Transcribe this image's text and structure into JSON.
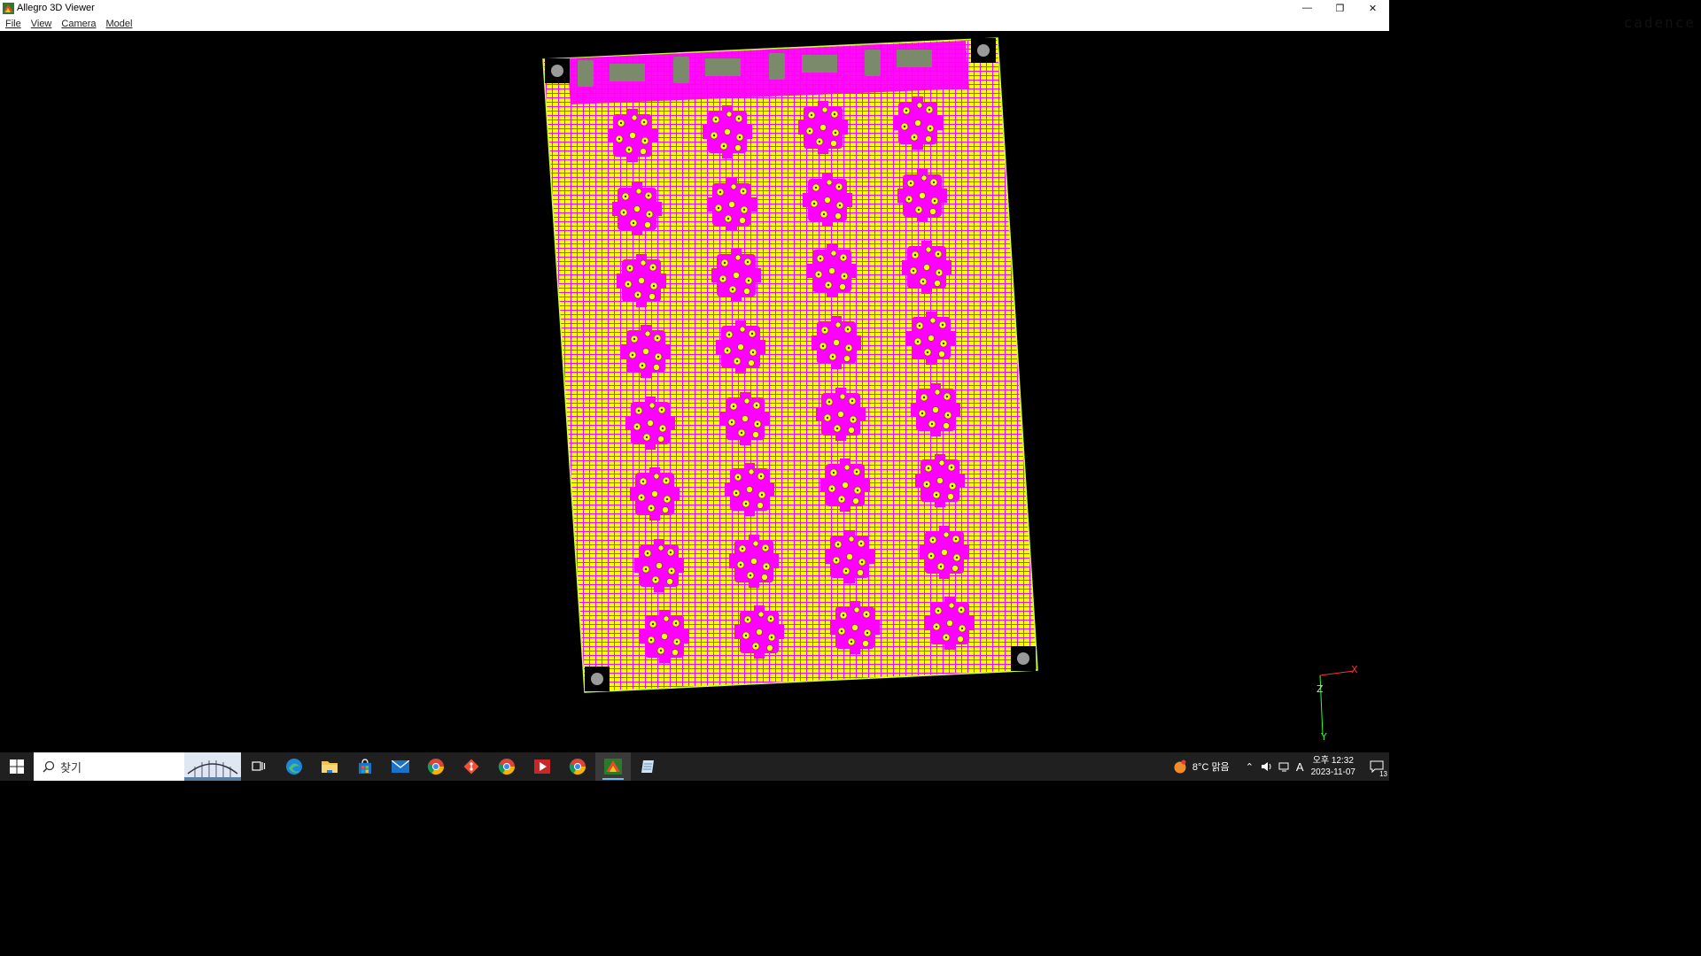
{
  "window": {
    "title": "Allegro 3D Viewer",
    "minimize_glyph": "—",
    "restore_glyph": "❐",
    "close_glyph": "✕"
  },
  "menu": {
    "items": [
      "File",
      "View",
      "Camera",
      "Model"
    ]
  },
  "brand": "cadence",
  "viewport": {
    "background": "#000000",
    "board_colors": {
      "substrate": "#ffff00",
      "copper": "#ff00ff",
      "outline": "#c8ff3c",
      "pads": "#7a8a6a",
      "mount_holes": "#9a9a9a"
    },
    "axes": {
      "x_label": "X",
      "y_label": "Y",
      "z_label": "Z"
    }
  },
  "taskbar": {
    "search_placeholder": "찾기",
    "icons": [
      "windows-start-icon",
      "task-view-icon",
      "edge-icon",
      "file-explorer-icon",
      "store-icon",
      "mail-icon",
      "chrome-icon",
      "git-icon",
      "chrome-alt-icon",
      "media-icon",
      "chrome-profile-icon",
      "allegro-icon",
      "notepad-icon"
    ],
    "weather": "8°C 맑음",
    "ime": "A",
    "time": "오후 12:32",
    "date": "2023-11-07",
    "notifications": "13"
  }
}
